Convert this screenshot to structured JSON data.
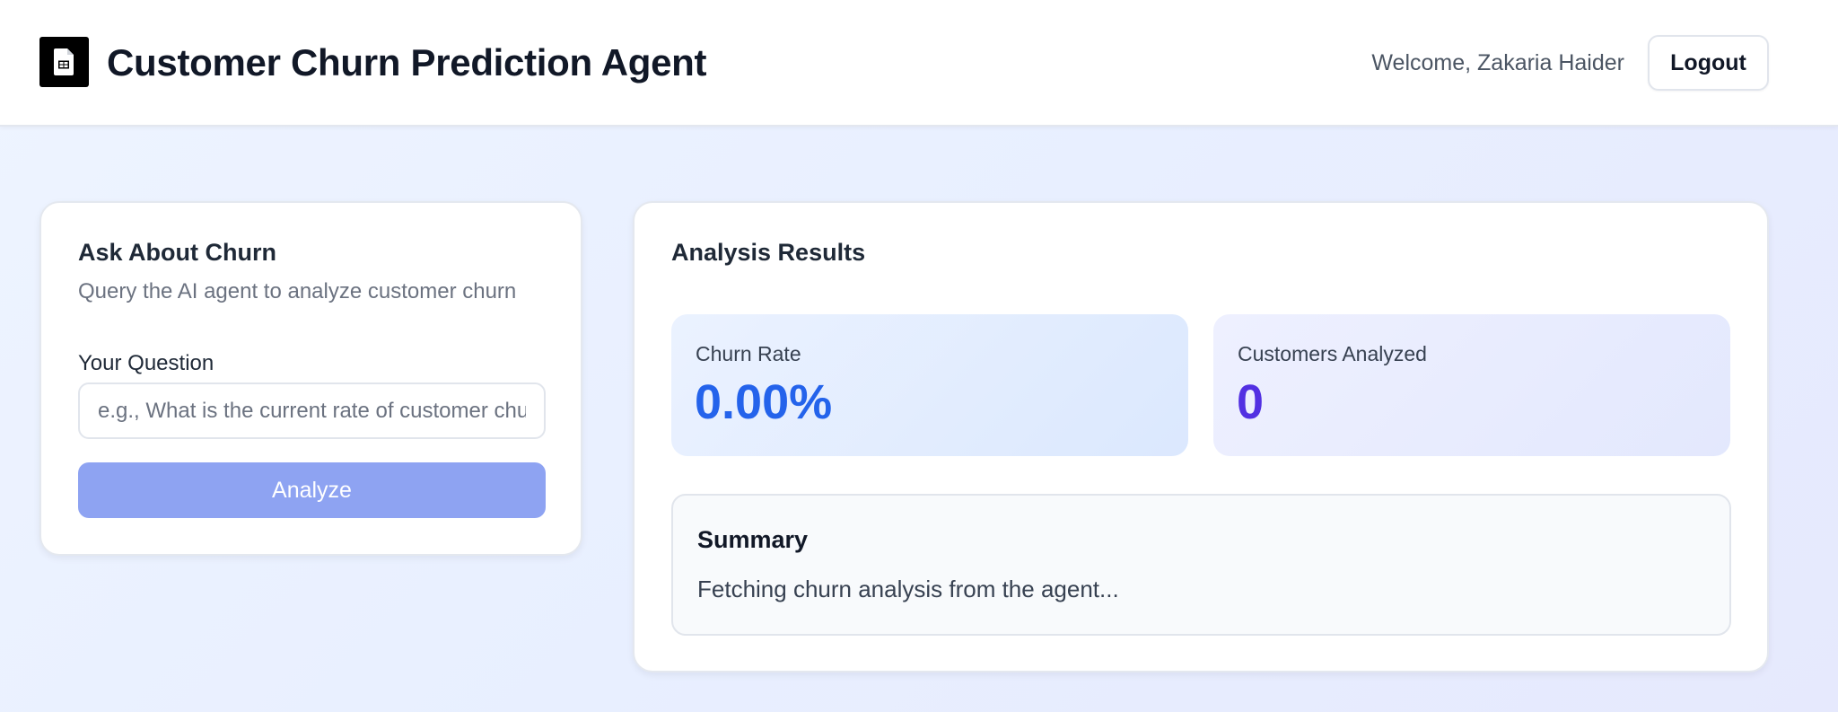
{
  "header": {
    "logo_icon": "spreadsheet-document-icon",
    "title": "Customer Churn Prediction Agent",
    "welcome_text": "Welcome, Zakaria Haider",
    "logout_label": "Logout"
  },
  "ask_panel": {
    "title": "Ask About Churn",
    "subtitle": "Query the AI agent to analyze customer churn",
    "question_label": "Your Question",
    "question_value": "",
    "question_placeholder": "e.g., What is the current rate of customer churn?",
    "analyze_label": "Analyze"
  },
  "results_panel": {
    "title": "Analysis Results",
    "churn_rate_label": "Churn Rate",
    "churn_rate_value": "0.00%",
    "customers_label": "Customers Analyzed",
    "customers_value": "0",
    "summary_title": "Summary",
    "summary_text": "Fetching churn analysis from the agent..."
  },
  "colors": {
    "page_background": "#e8efff",
    "analyze_button": "#8ea3f2",
    "churn_rate_value": "#2463eb",
    "customers_value": "#5230e2"
  }
}
